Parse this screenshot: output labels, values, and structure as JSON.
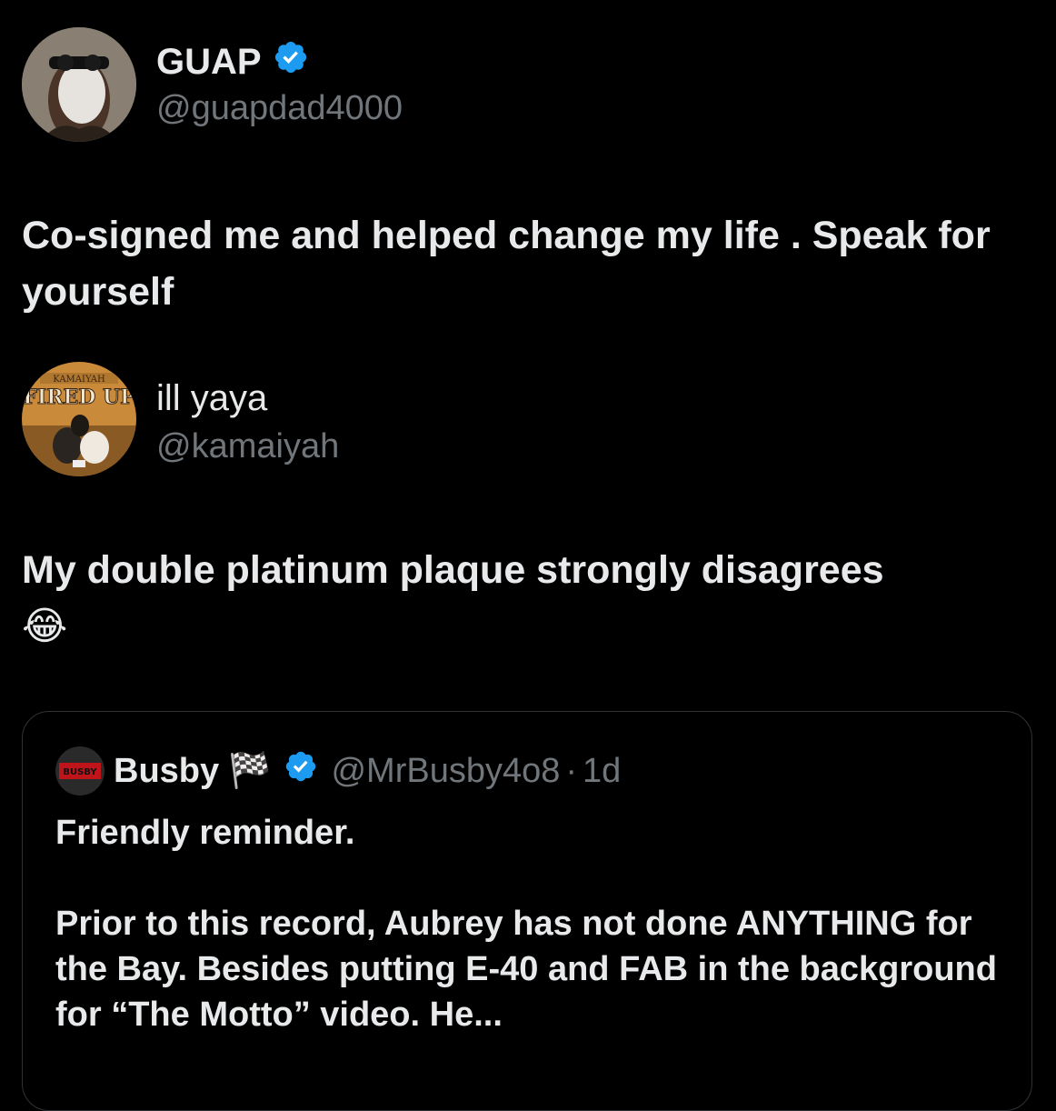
{
  "tweet1": {
    "display_name": "GUAP",
    "handle": "@guapdad4000",
    "verified": true,
    "text": "Co-signed me and helped change my life . Speak for yourself",
    "avatar": "avatar-man-face-mask"
  },
  "tweet2": {
    "display_name": "ill yaya",
    "handle": "@kamaiyah",
    "verified": false,
    "text": "My double platinum plaque strongly disagrees",
    "emoji": "😂",
    "avatar": "album-cover-fired-up",
    "avatar_text_top": "KAMAIYAH",
    "avatar_text_main": "FIRED UP"
  },
  "quote": {
    "display_name": "Busby",
    "flag": "🏁",
    "verified": true,
    "handle": "@MrBusby4o8",
    "separator": "·",
    "time": "1d",
    "avatar_text": "BUSBY",
    "line1": "Friendly reminder.",
    "paragraph2": "Prior to this record, Aubrey has not done ANYTHING for the Bay.  Besides putting E-40 and FAB in the background for “The Motto” video.  He..."
  },
  "colors": {
    "background": "#000000",
    "primary_text": "#e7e9ea",
    "secondary_text": "#71767b",
    "verified_blue": "#1d9bf0",
    "card_border": "#2f3336"
  }
}
